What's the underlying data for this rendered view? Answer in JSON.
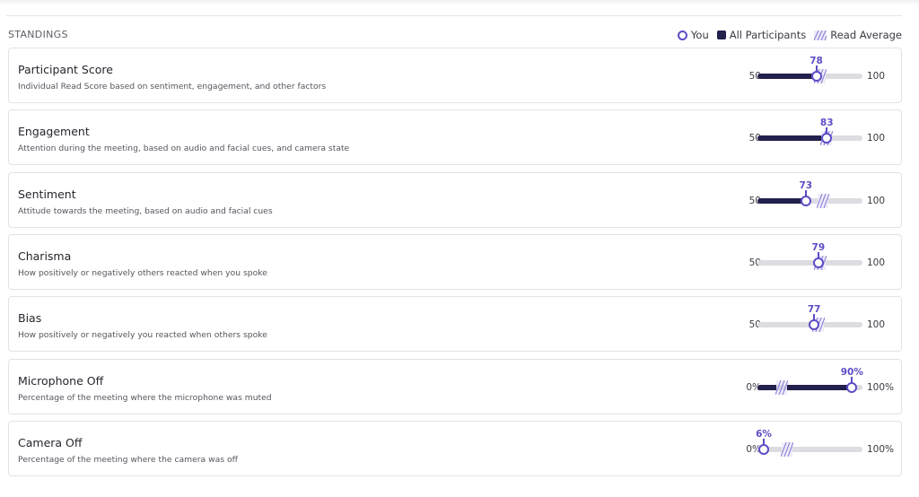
{
  "section_title": "STANDINGS",
  "legend": {
    "you": "You",
    "all": "All Participants",
    "avg": "Read Average"
  },
  "colors": {
    "accent": "#5b4dc6",
    "fill": "#22204d",
    "track": "#dcdce1"
  },
  "metrics": [
    {
      "title": "Participant Score",
      "desc": "Individual Read Score based on sentiment, engagement, and other factors",
      "min_label": "50",
      "max_label": "100",
      "min": 50,
      "max": 100,
      "value": 78,
      "value_label": "78",
      "avg": 80,
      "show_fill": true
    },
    {
      "title": "Engagement",
      "desc": "Attention during the meeting, based on audio and facial cues, and camera state",
      "min_label": "50",
      "max_label": "100",
      "min": 50,
      "max": 100,
      "value": 83,
      "value_label": "83",
      "avg": 83,
      "show_fill": true
    },
    {
      "title": "Sentiment",
      "desc": "Attitude towards the meeting, based on audio and facial cues",
      "min_label": "50",
      "max_label": "100",
      "min": 50,
      "max": 100,
      "value": 73,
      "value_label": "73",
      "avg": 81,
      "show_fill": true
    },
    {
      "title": "Charisma",
      "desc": "How positively or negatively others reacted when you spoke",
      "min_label": "50",
      "max_label": "100",
      "min": 50,
      "max": 100,
      "value": 79,
      "value_label": "79",
      "avg": 80,
      "show_fill": false
    },
    {
      "title": "Bias",
      "desc": "How positively or negatively you reacted when others spoke",
      "min_label": "50",
      "max_label": "100",
      "min": 50,
      "max": 100,
      "value": 77,
      "value_label": "77",
      "avg": 79,
      "show_fill": false
    },
    {
      "title": "Microphone Off",
      "desc": "Percentage of the meeting where the microphone was muted",
      "min_label": "0%",
      "max_label": "100%",
      "min": 0,
      "max": 100,
      "value": 90,
      "value_label": "90%",
      "avg": 23,
      "show_fill": true
    },
    {
      "title": "Camera Off",
      "desc": "Percentage of the meeting where the camera was off",
      "min_label": "0%",
      "max_label": "100%",
      "min": 0,
      "max": 100,
      "value": 6,
      "value_label": "6%",
      "avg": 28,
      "show_fill": false
    }
  ]
}
